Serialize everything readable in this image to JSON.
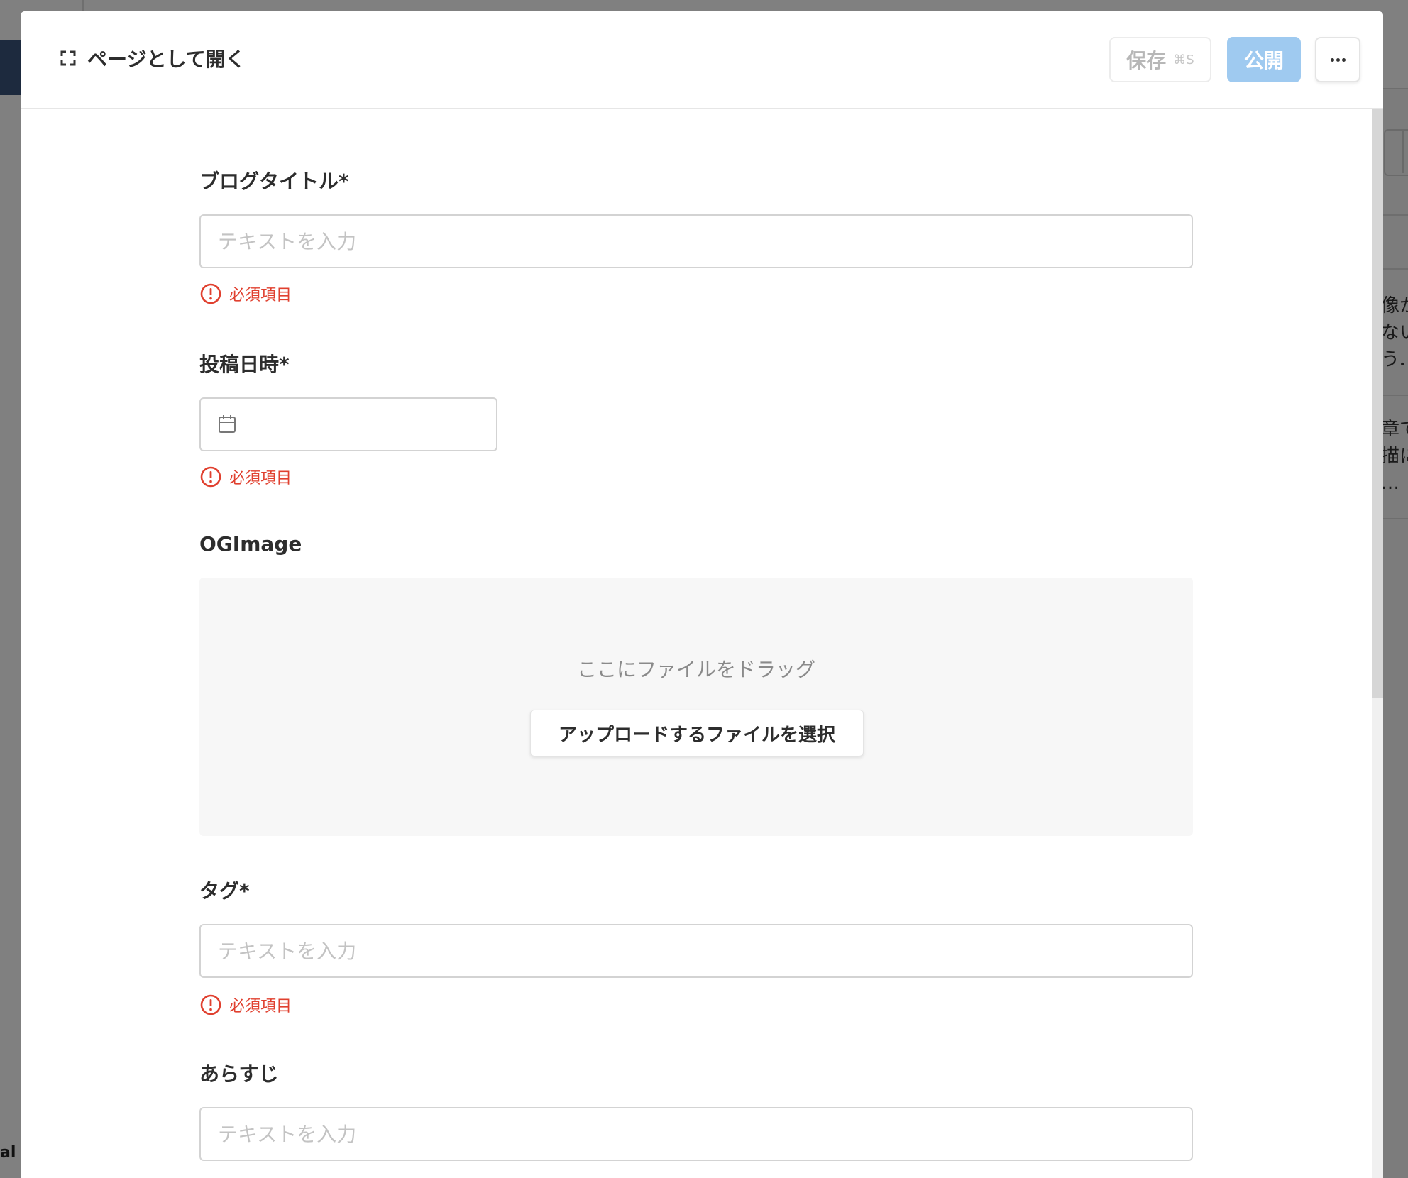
{
  "header": {
    "open_as_page": "ページとして開く",
    "save_label": "保存",
    "save_shortcut": "⌘S",
    "publish_label": "公開",
    "more_icon": "ellipsis-icon"
  },
  "fields": {
    "title": {
      "label": "ブログタイトル*",
      "placeholder": "テキストを入力",
      "error": "必須項目"
    },
    "date": {
      "label": "投稿日時*",
      "icon": "calendar-icon",
      "error": "必須項目"
    },
    "ogimage": {
      "label": "OGImage",
      "drop_hint": "ここにファイルをドラッグ",
      "upload_button": "アップロードするファイルを選択"
    },
    "tags": {
      "label": "タグ*",
      "placeholder": "テキストを入力",
      "error": "必須項目"
    },
    "summary": {
      "label": "あらすじ",
      "placeholder": "テキストを入力"
    }
  },
  "background": {
    "left_text": "al",
    "right_text_1": "像か\nない\nう．",
    "right_text_2": "章で\n描に\n…"
  },
  "colors": {
    "error": "#e0402f",
    "publish_disabled": "#9fcaf0",
    "overlay": "#7f7f7f"
  }
}
